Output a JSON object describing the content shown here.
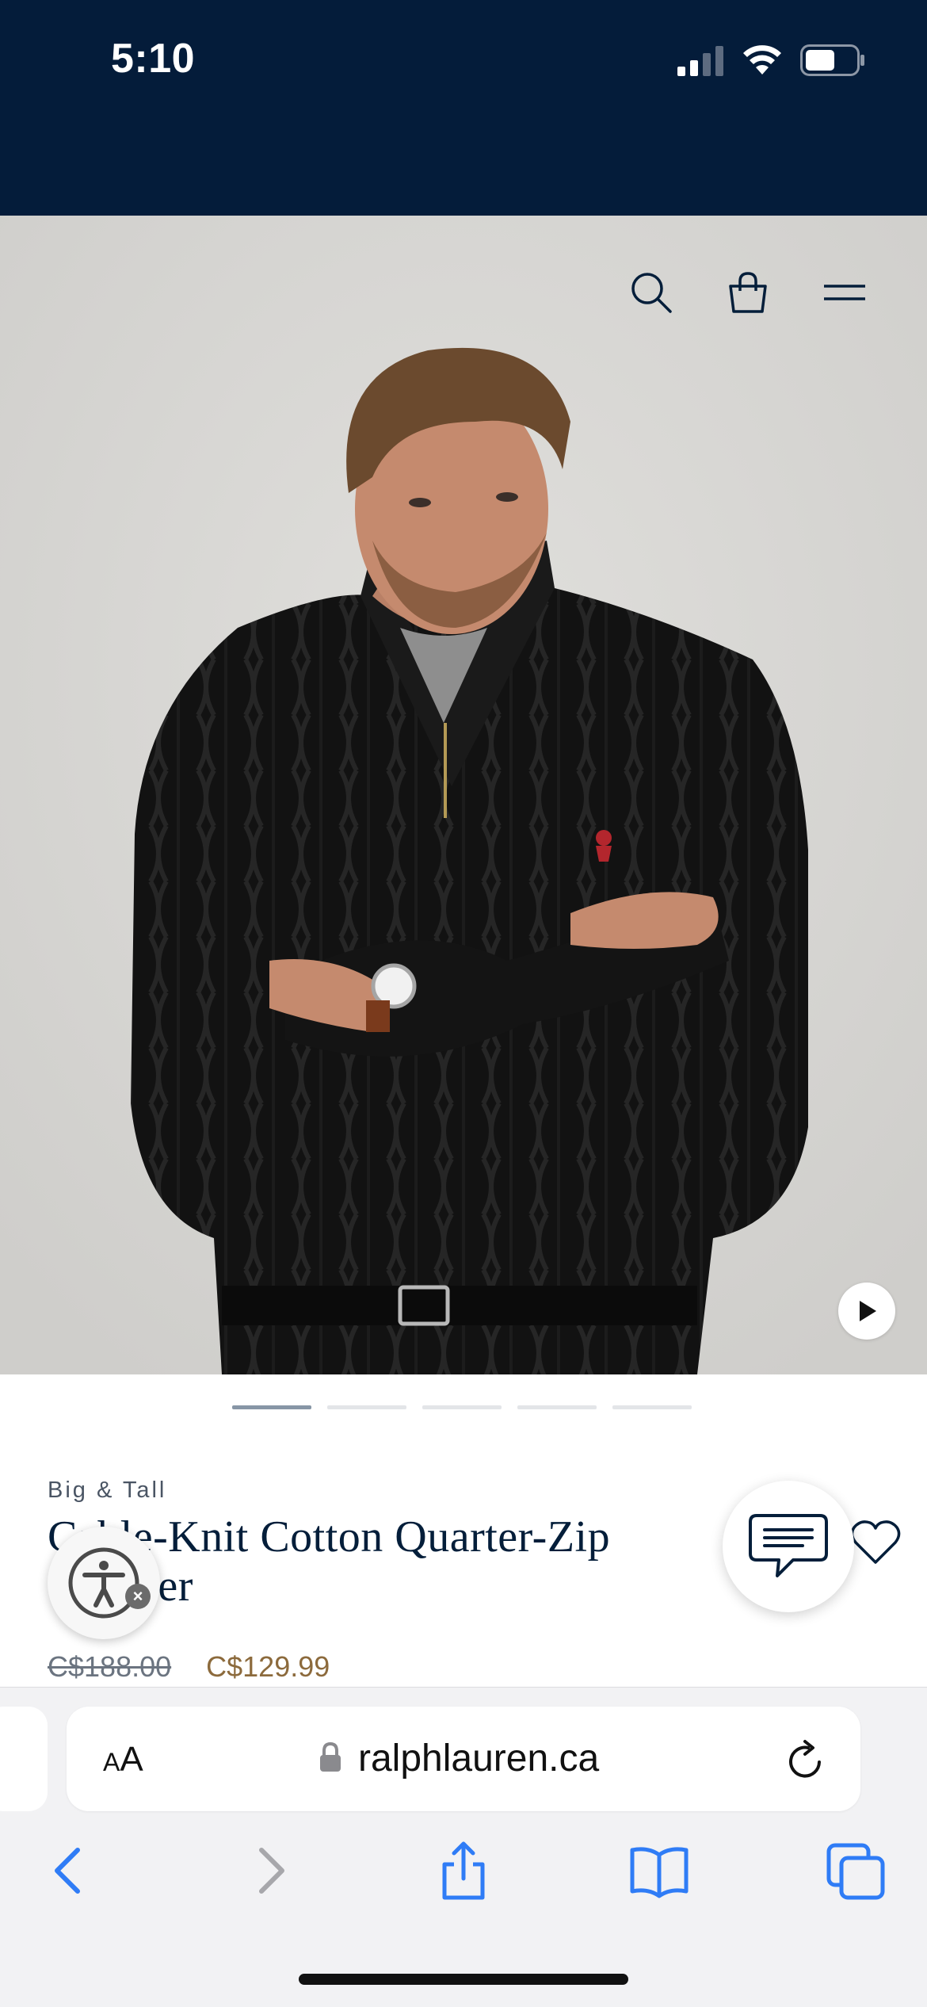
{
  "status_bar": {
    "time": "5:10",
    "background_color": "#041c3a"
  },
  "header_icons": [
    "search-icon",
    "bag-icon",
    "menu-icon"
  ],
  "carousel": {
    "total_slides": 5,
    "active_slide": 1
  },
  "product": {
    "brand_line": "Big & Tall",
    "title": "Cable-Knit Cotton Quarter-Zip Sweater",
    "price_original": "C$188.00",
    "price_sale": "C$129.99"
  },
  "floating": {
    "chat": "chat-bubble-icon",
    "accessibility": "accessibility-icon"
  },
  "browser": {
    "aa_small": "A",
    "aa_large": "A",
    "url": "ralphlauren.ca"
  },
  "colors": {
    "navy": "#041e3a",
    "sale_price": "#8c6a3c",
    "safari_blue": "#2f7cf6"
  }
}
